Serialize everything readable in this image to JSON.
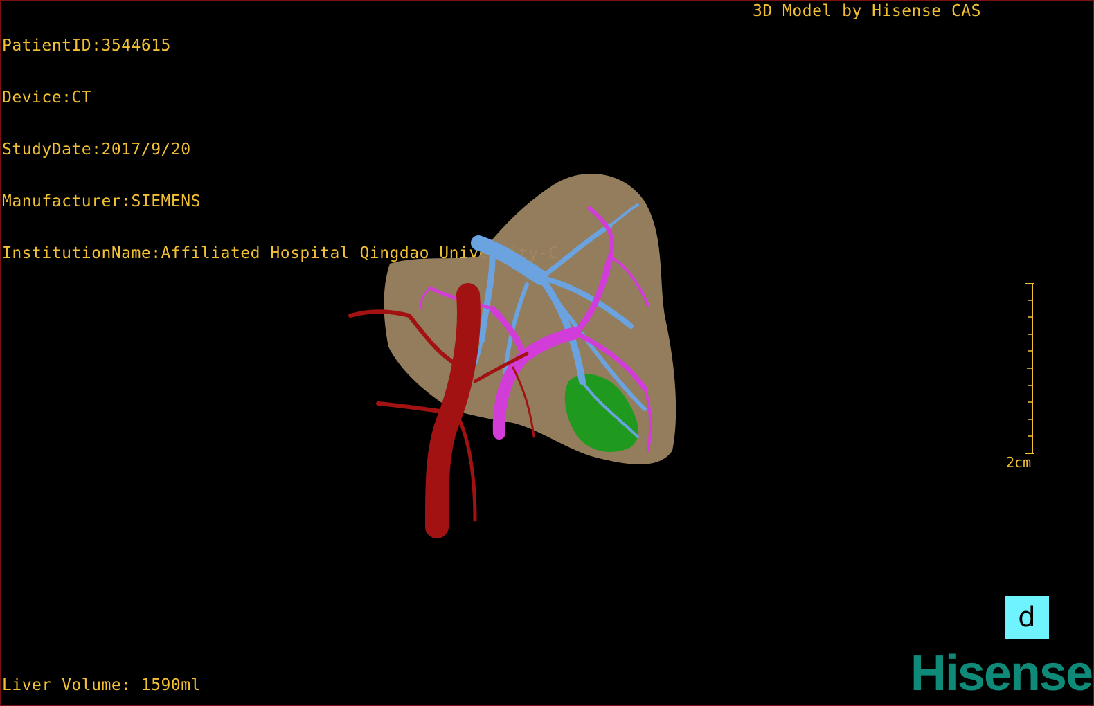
{
  "patient_info": {
    "patient_id": "PatientID:3544615",
    "device": "Device:CT",
    "study_date": "StudyDate:2017/9/20",
    "manufacturer": "Manufacturer:SIEMENS",
    "institution": "InstitutionName:Affiliated Hospital Qingdao University-C"
  },
  "credit": "3D Model by Hisense CAS",
  "scale": {
    "label": "2cm"
  },
  "view_badge": "d",
  "volume": "Liver Volume: 1590ml",
  "brand": "Hisense",
  "colors": {
    "overlay_text": "#f2c033",
    "liver": "#9b8462",
    "artery": "#a31212",
    "portal_vein": "#d23cd8",
    "hepatic_vein": "#6aa3e0",
    "gallbladder": "#1f9a1f",
    "badge": "#6ff3ff",
    "brand": "#0f8a78"
  }
}
